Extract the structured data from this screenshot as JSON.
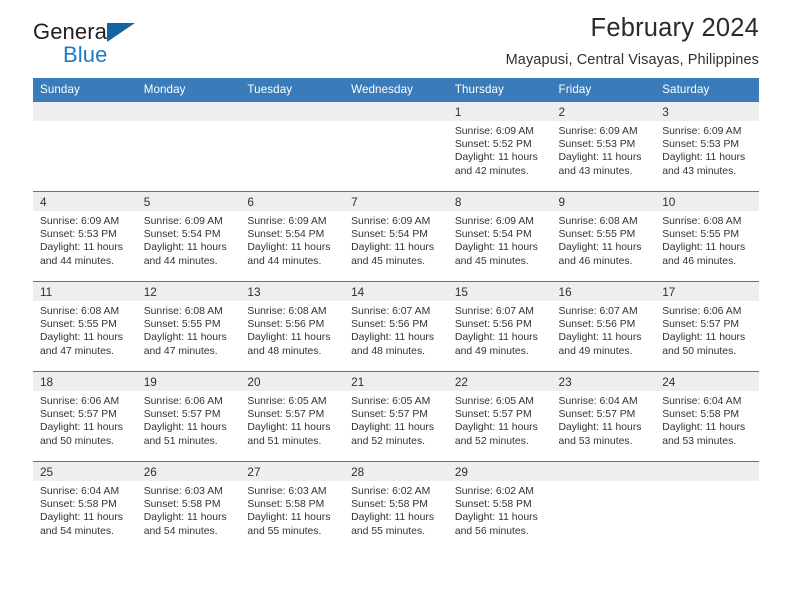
{
  "brand": {
    "name_part1": "General",
    "name_part2": "Blue",
    "accent_color": "#1f7ac4",
    "triangle_color": "#1264a3"
  },
  "header": {
    "title": "February 2024",
    "subtitle": "Mayapusi, Central Visayas, Philippines"
  },
  "calendar": {
    "header_bg": "#3a7cb9",
    "daynum_bg": "#eeeeee",
    "weekday_headers": [
      "Sunday",
      "Monday",
      "Tuesday",
      "Wednesday",
      "Thursday",
      "Friday",
      "Saturday"
    ],
    "weeks": [
      [
        {
          "day": "",
          "blank": true,
          "lines": []
        },
        {
          "day": "",
          "blank": true,
          "lines": []
        },
        {
          "day": "",
          "blank": true,
          "lines": []
        },
        {
          "day": "",
          "blank": true,
          "lines": []
        },
        {
          "day": "1",
          "blank": false,
          "lines": [
            "Sunrise: 6:09 AM",
            "Sunset: 5:52 PM",
            "Daylight: 11 hours",
            "and 42 minutes."
          ]
        },
        {
          "day": "2",
          "blank": false,
          "lines": [
            "Sunrise: 6:09 AM",
            "Sunset: 5:53 PM",
            "Daylight: 11 hours",
            "and 43 minutes."
          ]
        },
        {
          "day": "3",
          "blank": false,
          "lines": [
            "Sunrise: 6:09 AM",
            "Sunset: 5:53 PM",
            "Daylight: 11 hours",
            "and 43 minutes."
          ]
        }
      ],
      [
        {
          "day": "4",
          "blank": false,
          "lines": [
            "Sunrise: 6:09 AM",
            "Sunset: 5:53 PM",
            "Daylight: 11 hours",
            "and 44 minutes."
          ]
        },
        {
          "day": "5",
          "blank": false,
          "lines": [
            "Sunrise: 6:09 AM",
            "Sunset: 5:54 PM",
            "Daylight: 11 hours",
            "and 44 minutes."
          ]
        },
        {
          "day": "6",
          "blank": false,
          "lines": [
            "Sunrise: 6:09 AM",
            "Sunset: 5:54 PM",
            "Daylight: 11 hours",
            "and 44 minutes."
          ]
        },
        {
          "day": "7",
          "blank": false,
          "lines": [
            "Sunrise: 6:09 AM",
            "Sunset: 5:54 PM",
            "Daylight: 11 hours",
            "and 45 minutes."
          ]
        },
        {
          "day": "8",
          "blank": false,
          "lines": [
            "Sunrise: 6:09 AM",
            "Sunset: 5:54 PM",
            "Daylight: 11 hours",
            "and 45 minutes."
          ]
        },
        {
          "day": "9",
          "blank": false,
          "lines": [
            "Sunrise: 6:08 AM",
            "Sunset: 5:55 PM",
            "Daylight: 11 hours",
            "and 46 minutes."
          ]
        },
        {
          "day": "10",
          "blank": false,
          "lines": [
            "Sunrise: 6:08 AM",
            "Sunset: 5:55 PM",
            "Daylight: 11 hours",
            "and 46 minutes."
          ]
        }
      ],
      [
        {
          "day": "11",
          "blank": false,
          "lines": [
            "Sunrise: 6:08 AM",
            "Sunset: 5:55 PM",
            "Daylight: 11 hours",
            "and 47 minutes."
          ]
        },
        {
          "day": "12",
          "blank": false,
          "lines": [
            "Sunrise: 6:08 AM",
            "Sunset: 5:55 PM",
            "Daylight: 11 hours",
            "and 47 minutes."
          ]
        },
        {
          "day": "13",
          "blank": false,
          "lines": [
            "Sunrise: 6:08 AM",
            "Sunset: 5:56 PM",
            "Daylight: 11 hours",
            "and 48 minutes."
          ]
        },
        {
          "day": "14",
          "blank": false,
          "lines": [
            "Sunrise: 6:07 AM",
            "Sunset: 5:56 PM",
            "Daylight: 11 hours",
            "and 48 minutes."
          ]
        },
        {
          "day": "15",
          "blank": false,
          "lines": [
            "Sunrise: 6:07 AM",
            "Sunset: 5:56 PM",
            "Daylight: 11 hours",
            "and 49 minutes."
          ]
        },
        {
          "day": "16",
          "blank": false,
          "lines": [
            "Sunrise: 6:07 AM",
            "Sunset: 5:56 PM",
            "Daylight: 11 hours",
            "and 49 minutes."
          ]
        },
        {
          "day": "17",
          "blank": false,
          "lines": [
            "Sunrise: 6:06 AM",
            "Sunset: 5:57 PM",
            "Daylight: 11 hours",
            "and 50 minutes."
          ]
        }
      ],
      [
        {
          "day": "18",
          "blank": false,
          "lines": [
            "Sunrise: 6:06 AM",
            "Sunset: 5:57 PM",
            "Daylight: 11 hours",
            "and 50 minutes."
          ]
        },
        {
          "day": "19",
          "blank": false,
          "lines": [
            "Sunrise: 6:06 AM",
            "Sunset: 5:57 PM",
            "Daylight: 11 hours",
            "and 51 minutes."
          ]
        },
        {
          "day": "20",
          "blank": false,
          "lines": [
            "Sunrise: 6:05 AM",
            "Sunset: 5:57 PM",
            "Daylight: 11 hours",
            "and 51 minutes."
          ]
        },
        {
          "day": "21",
          "blank": false,
          "lines": [
            "Sunrise: 6:05 AM",
            "Sunset: 5:57 PM",
            "Daylight: 11 hours",
            "and 52 minutes."
          ]
        },
        {
          "day": "22",
          "blank": false,
          "lines": [
            "Sunrise: 6:05 AM",
            "Sunset: 5:57 PM",
            "Daylight: 11 hours",
            "and 52 minutes."
          ]
        },
        {
          "day": "23",
          "blank": false,
          "lines": [
            "Sunrise: 6:04 AM",
            "Sunset: 5:57 PM",
            "Daylight: 11 hours",
            "and 53 minutes."
          ]
        },
        {
          "day": "24",
          "blank": false,
          "lines": [
            "Sunrise: 6:04 AM",
            "Sunset: 5:58 PM",
            "Daylight: 11 hours",
            "and 53 minutes."
          ]
        }
      ],
      [
        {
          "day": "25",
          "blank": false,
          "lines": [
            "Sunrise: 6:04 AM",
            "Sunset: 5:58 PM",
            "Daylight: 11 hours",
            "and 54 minutes."
          ]
        },
        {
          "day": "26",
          "blank": false,
          "lines": [
            "Sunrise: 6:03 AM",
            "Sunset: 5:58 PM",
            "Daylight: 11 hours",
            "and 54 minutes."
          ]
        },
        {
          "day": "27",
          "blank": false,
          "lines": [
            "Sunrise: 6:03 AM",
            "Sunset: 5:58 PM",
            "Daylight: 11 hours",
            "and 55 minutes."
          ]
        },
        {
          "day": "28",
          "blank": false,
          "lines": [
            "Sunrise: 6:02 AM",
            "Sunset: 5:58 PM",
            "Daylight: 11 hours",
            "and 55 minutes."
          ]
        },
        {
          "day": "29",
          "blank": false,
          "lines": [
            "Sunrise: 6:02 AM",
            "Sunset: 5:58 PM",
            "Daylight: 11 hours",
            "and 56 minutes."
          ]
        },
        {
          "day": "",
          "blank": true,
          "lines": []
        },
        {
          "day": "",
          "blank": true,
          "lines": []
        }
      ]
    ]
  }
}
